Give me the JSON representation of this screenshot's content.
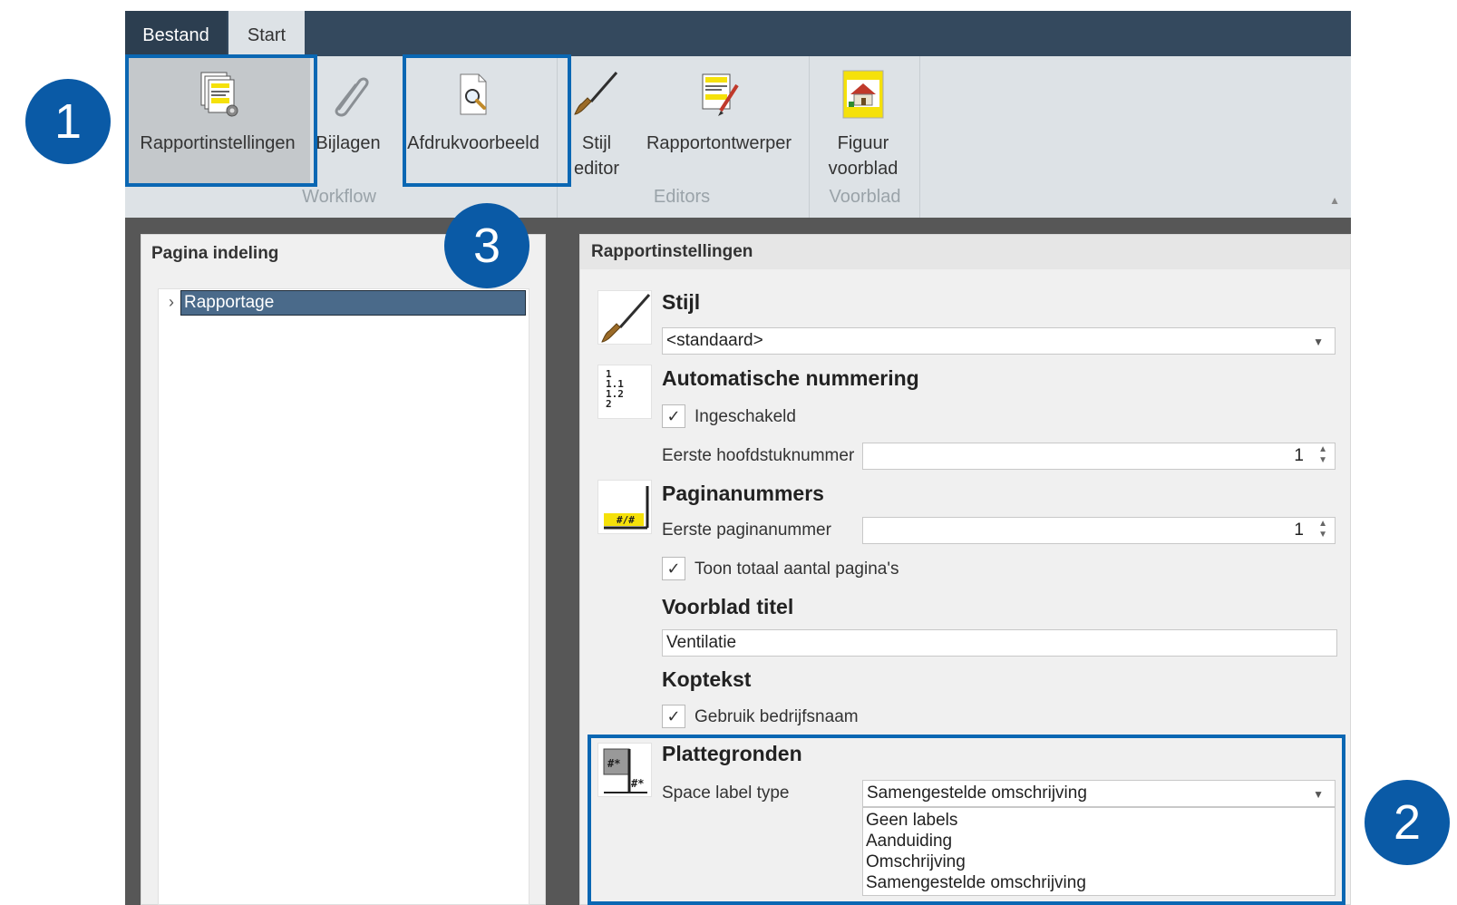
{
  "tabs": {
    "file": "Bestand",
    "start": "Start"
  },
  "ribbon": {
    "report_settings": "Rapportinstellingen",
    "attachments": "Bijlagen",
    "print_preview": "Afdrukvoorbeeld",
    "style_editor_line1": "Stijl",
    "style_editor_line2": "editor",
    "report_designer": "Rapportontwerper",
    "cover_figure_line1": "Figuur",
    "cover_figure_line2": "voorblad",
    "group_workflow": "Workflow",
    "group_editors": "Editors",
    "group_cover": "Voorblad"
  },
  "badges": {
    "one": "1",
    "two": "2",
    "three": "3"
  },
  "left_panel": {
    "title": "Pagina indeling",
    "tree_item": "Rapportage"
  },
  "right_panel": {
    "title": "Rapportinstellingen",
    "style": {
      "heading": "Stijl",
      "value": "<standaard>"
    },
    "numbering": {
      "heading": "Automatische nummering",
      "enabled_label": "Ingeschakeld",
      "enabled": true,
      "first_chapter_label": "Eerste hoofdstuknummer",
      "first_chapter_value": "1"
    },
    "page_numbers": {
      "heading": "Paginanummers",
      "first_page_label": "Eerste paginanummer",
      "first_page_value": "1",
      "show_total_label": "Toon totaal aantal pagina's",
      "show_total": true
    },
    "cover_title": {
      "heading": "Voorblad titel",
      "value": "Ventilatie"
    },
    "header_text": {
      "heading": "Koptekst",
      "use_company_label": "Gebruik bedrijfsnaam",
      "use_company": true
    },
    "floorplans": {
      "heading": "Plattegronden",
      "space_label_type_label": "Space label type",
      "space_label_type_value": "Samengestelde omschrijving",
      "options": [
        "Geen labels",
        "Aanduiding",
        "Omschrijving",
        "Samengestelde omschrijving"
      ]
    }
  },
  "icons": {
    "numbering_lines": [
      "1",
      "1.1",
      "1.2",
      "2"
    ],
    "page_number_glyph": "#/#"
  },
  "colors": {
    "accent": "#0a5aa6",
    "tabbar": "#34495e",
    "ribbon": "#dde2e6",
    "selection": "#4a6a8a"
  }
}
